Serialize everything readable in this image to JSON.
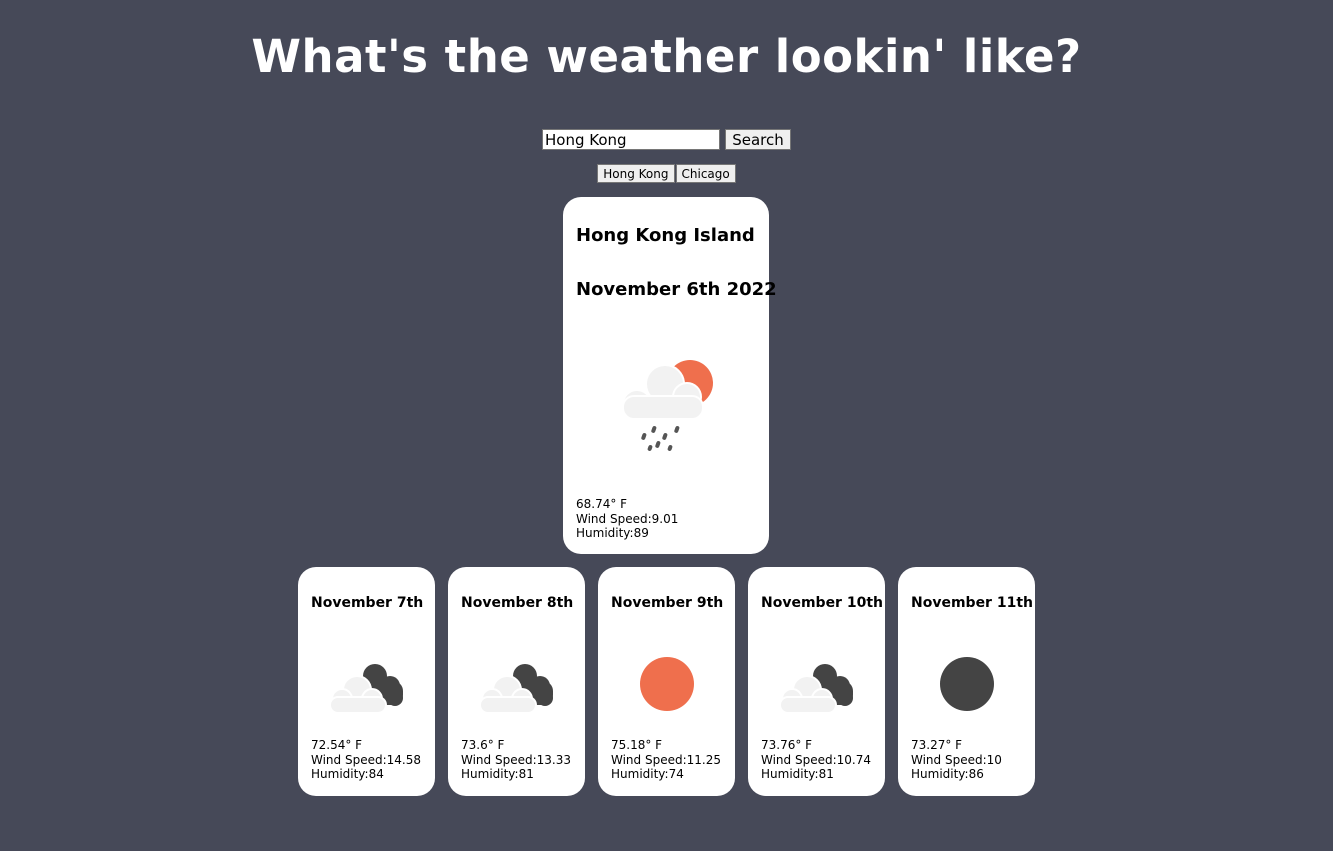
{
  "header": {
    "title": "What's the weather lookin' like?"
  },
  "search": {
    "value": "Hong Kong",
    "button_label": "Search"
  },
  "history": [
    "Hong Kong",
    "Chicago"
  ],
  "current": {
    "city": "Hong Kong Island",
    "date": "November 6th 2022",
    "icon": "cloud-sun-rain-icon",
    "temp": "68.74° F",
    "wind": "Wind Speed:9.01",
    "humidity": "Humidity:89"
  },
  "forecast": [
    {
      "date": "November 7th",
      "icon": "dark-clouds-icon",
      "temp": "72.54° F",
      "wind": "Wind Speed:14.58",
      "humidity": "Humidity:84"
    },
    {
      "date": "November 8th",
      "icon": "dark-clouds-icon",
      "temp": "73.6° F",
      "wind": "Wind Speed:13.33",
      "humidity": "Humidity:81"
    },
    {
      "date": "November 9th",
      "icon": "sun-icon",
      "temp": "75.18° F",
      "wind": "Wind Speed:11.25",
      "humidity": "Humidity:74"
    },
    {
      "date": "November 10th",
      "icon": "dark-clouds-icon",
      "temp": "73.76° F",
      "wind": "Wind Speed:10.74",
      "humidity": "Humidity:81"
    },
    {
      "date": "November 11th",
      "icon": "moon-icon",
      "temp": "73.27° F",
      "wind": "Wind Speed:10",
      "humidity": "Humidity:86"
    }
  ],
  "colors": {
    "background": "#464958",
    "sun": "#ef6f4d",
    "cloud": "#f2f2f2",
    "dark": "#444444"
  }
}
